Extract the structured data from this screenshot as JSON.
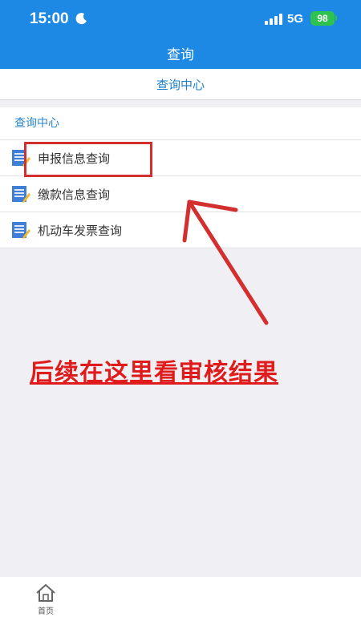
{
  "status_bar": {
    "time": "15:00",
    "network": "5G",
    "battery": "98"
  },
  "header": {
    "title": "查询"
  },
  "tab": {
    "label": "查询中心"
  },
  "section": {
    "title": "查询中心",
    "items": [
      {
        "label": "申报信息查询",
        "icon": "document-edit-icon"
      },
      {
        "label": "缴款信息查询",
        "icon": "document-edit-icon"
      },
      {
        "label": "机动车发票查询",
        "icon": "document-edit-icon"
      }
    ]
  },
  "annotation": {
    "text": "后续在这里看审核结果",
    "color": "#e01b1b"
  },
  "bottom_nav": {
    "home_label": "首页"
  },
  "colors": {
    "primary": "#1e88e5",
    "highlight": "#d32f2f"
  }
}
